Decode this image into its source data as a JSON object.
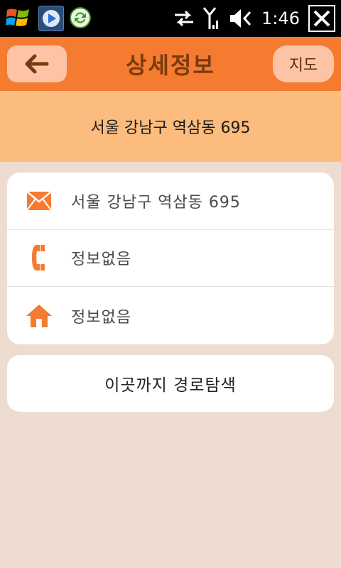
{
  "status_bar": {
    "time": "1:46",
    "icons": [
      "windows-logo-icon",
      "media-player-icon",
      "sync-icon",
      "data-transfer-icon",
      "signal-icon",
      "volume-muted-icon",
      "close-icon"
    ]
  },
  "header": {
    "title": "상세정보",
    "map_button": "지도",
    "back_icon": "arrow-left-icon"
  },
  "banner": {
    "address": "서울 강남구 역삼동  695"
  },
  "info": {
    "rows": [
      {
        "icon": "mail-icon",
        "text": "서울 강남구 역삼동  695"
      },
      {
        "icon": "phone-icon",
        "text": "정보없음"
      },
      {
        "icon": "home-icon",
        "text": "정보없음"
      }
    ]
  },
  "route_button": "이곳까지 경로탐색",
  "colors": {
    "accent": "#f47b30",
    "banner": "#fcbc7e",
    "background": "#eedcd0",
    "button_light": "#fcc4a4",
    "title_text": "#7a3a10"
  }
}
